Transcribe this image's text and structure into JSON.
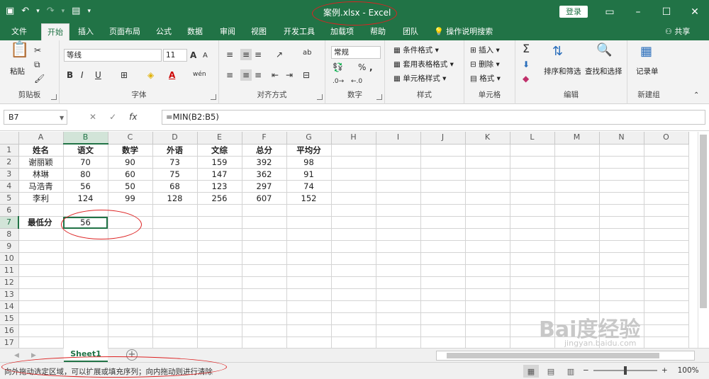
{
  "window": {
    "title": "案例.xlsx  -  Excel",
    "login_label": "登录",
    "minimize": "–",
    "maximize": "☐",
    "close": "✕",
    "ribbon_options": "▭"
  },
  "qat": {
    "save": "💾",
    "undo": "↶",
    "undo_arrow": "▾",
    "redo": "↷",
    "redo_arrow": "▾",
    "format": "🗂",
    "more": "▾"
  },
  "tabs": [
    "文件",
    "开始",
    "插入",
    "页面布局",
    "公式",
    "数据",
    "审阅",
    "视图",
    "开发工具",
    "加载项",
    "帮助",
    "团队"
  ],
  "active_tab": "开始",
  "tell_me": "操作说明搜索",
  "share": "共享",
  "ribbon": {
    "clipboard": {
      "label": "剪贴板",
      "paste": "粘贴"
    },
    "font": {
      "label": "字体",
      "font_name": "等线",
      "font_size": "11",
      "grow": "A",
      "shrink": "A",
      "bold": "B",
      "italic": "I",
      "underline": "U",
      "phonetic": "wén"
    },
    "alignment": {
      "label": "对齐方式",
      "wrap": "ab"
    },
    "number": {
      "label": "数字",
      "format": "常规",
      "percent": "%",
      "comma": ","
    },
    "styles": {
      "label": "样式",
      "conditional": "条件格式",
      "table": "套用表格格式",
      "cell": "单元格样式"
    },
    "cells": {
      "label": "单元格",
      "insert": "插入",
      "delete": "删除",
      "format": "格式"
    },
    "editing": {
      "label": "编辑",
      "sort": "排序和筛选",
      "find": "查找和选择",
      "sum": "Σ"
    },
    "newgroup": {
      "label": "新建组",
      "form": "记录单"
    }
  },
  "formula_bar": {
    "name_box": "B7",
    "cancel": "✕",
    "enter": "✓",
    "fx": "fx",
    "formula": "=MIN(B2:B5)"
  },
  "columns": [
    "A",
    "B",
    "C",
    "D",
    "E",
    "F",
    "G",
    "H",
    "I",
    "J",
    "K",
    "L",
    "M",
    "N",
    "O"
  ],
  "rows": [
    [
      "姓名",
      "语文",
      "数学",
      "外语",
      "文综",
      "总分",
      "平均分",
      "",
      "",
      "",
      "",
      "",
      "",
      "",
      ""
    ],
    [
      "谢丽颖",
      "70",
      "90",
      "73",
      "159",
      "392",
      "98",
      "",
      "",
      "",
      "",
      "",
      "",
      "",
      ""
    ],
    [
      "林琳",
      "80",
      "60",
      "75",
      "147",
      "362",
      "91",
      "",
      "",
      "",
      "",
      "",
      "",
      "",
      ""
    ],
    [
      "马浩青",
      "56",
      "50",
      "68",
      "123",
      "297",
      "74",
      "",
      "",
      "",
      "",
      "",
      "",
      "",
      ""
    ],
    [
      "李利",
      "124",
      "99",
      "128",
      "256",
      "607",
      "152",
      "",
      "",
      "",
      "",
      "",
      "",
      "",
      ""
    ],
    [
      "",
      "",
      "",
      "",
      "",
      "",
      "",
      "",
      "",
      "",
      "",
      "",
      "",
      "",
      ""
    ],
    [
      "最低分",
      "56",
      "",
      "",
      "",
      "",
      "",
      "",
      "",
      "",
      "",
      "",
      "",
      "",
      ""
    ],
    [
      "",
      "",
      "",
      "",
      "",
      "",
      "",
      "",
      "",
      "",
      "",
      "",
      "",
      "",
      ""
    ],
    [
      "",
      "",
      "",
      "",
      "",
      "",
      "",
      "",
      "",
      "",
      "",
      "",
      "",
      "",
      ""
    ],
    [
      "",
      "",
      "",
      "",
      "",
      "",
      "",
      "",
      "",
      "",
      "",
      "",
      "",
      "",
      ""
    ],
    [
      "",
      "",
      "",
      "",
      "",
      "",
      "",
      "",
      "",
      "",
      "",
      "",
      "",
      "",
      ""
    ],
    [
      "",
      "",
      "",
      "",
      "",
      "",
      "",
      "",
      "",
      "",
      "",
      "",
      "",
      "",
      ""
    ],
    [
      "",
      "",
      "",
      "",
      "",
      "",
      "",
      "",
      "",
      "",
      "",
      "",
      "",
      "",
      ""
    ],
    [
      "",
      "",
      "",
      "",
      "",
      "",
      "",
      "",
      "",
      "",
      "",
      "",
      "",
      "",
      ""
    ],
    [
      "",
      "",
      "",
      "",
      "",
      "",
      "",
      "",
      "",
      "",
      "",
      "",
      "",
      "",
      ""
    ],
    [
      "",
      "",
      "",
      "",
      "",
      "",
      "",
      "",
      "",
      "",
      "",
      "",
      "",
      "",
      ""
    ],
    [
      "",
      "",
      "",
      "",
      "",
      "",
      "",
      "",
      "",
      "",
      "",
      "",
      "",
      "",
      ""
    ]
  ],
  "selected_cell": "B7",
  "sheet_tabs": [
    "Sheet1"
  ],
  "add_sheet": "+",
  "status_text": "向外拖动选定区域，可以扩展或填充序列；向内拖动则进行清除",
  "zoom": {
    "minus": "−",
    "plus": "+",
    "level": "100%",
    "fraction": 0.5
  },
  "watermark": {
    "text": "Bai度经验",
    "url": "jingyan.baidu.com"
  },
  "colors": {
    "brand": "#217346",
    "annotation": "#dd2222"
  }
}
